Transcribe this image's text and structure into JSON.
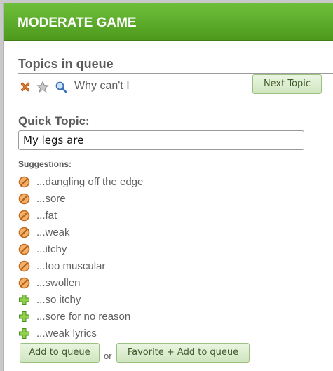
{
  "header": {
    "title": "MODERATE GAME"
  },
  "queue": {
    "heading": "Topics in queue",
    "topic_text": "Why can't I",
    "icons": [
      "delete-icon",
      "star-icon",
      "magnifier-icon"
    ],
    "next_label": "Next Topic"
  },
  "quick_topic": {
    "label": "Quick Topic:",
    "value": "My legs are",
    "suggestions_label": "Suggestions:",
    "suggestions": [
      {
        "text": "...dangling off the edge",
        "icon": "blocked-icon"
      },
      {
        "text": "...sore",
        "icon": "blocked-icon"
      },
      {
        "text": "...fat",
        "icon": "blocked-icon"
      },
      {
        "text": "...weak",
        "icon": "blocked-icon"
      },
      {
        "text": "...itchy",
        "icon": "blocked-icon"
      },
      {
        "text": "...too muscular",
        "icon": "blocked-icon"
      },
      {
        "text": "...swollen",
        "icon": "blocked-icon"
      },
      {
        "text": "...so itchy",
        "icon": "add-icon"
      },
      {
        "text": "...sore for no reason",
        "icon": "add-icon"
      },
      {
        "text": "...weak lyrics",
        "icon": "add-icon"
      }
    ]
  },
  "actions": {
    "add_label": "Add to queue",
    "or_text": "or",
    "favorite_label": "Favorite + Add to queue"
  },
  "colors": {
    "header_green": "#5aab2a",
    "blocked_orange": "#d9822b",
    "add_green": "#7cc23a"
  }
}
